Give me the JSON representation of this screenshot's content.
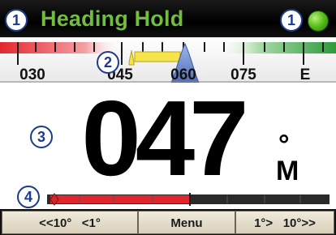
{
  "header": {
    "mode_title": "Heading Hold",
    "status_led_color": "#5cc11e",
    "title_color": "#6fbe3c"
  },
  "callouts": [
    "1",
    "1",
    "2",
    "3",
    "4"
  ],
  "compass": {
    "tick_labels": [
      "030",
      "045",
      "060",
      "075",
      "E"
    ],
    "current_heading_marker_color": "#6a86c9",
    "target_marker_color": "#f5e44a",
    "port_color": "#e3262e",
    "starboard_color": "#2d9a3a"
  },
  "heading": {
    "value": "047",
    "degree_symbol": "°",
    "reference": "M"
  },
  "rudder": {
    "indicator_color": "#d6262b",
    "fill_color": "#e0272d"
  },
  "softkeys": {
    "port_label": "<<10°   <1°",
    "menu_label": "Menu",
    "starboard_label": "1°>   10°>>"
  }
}
